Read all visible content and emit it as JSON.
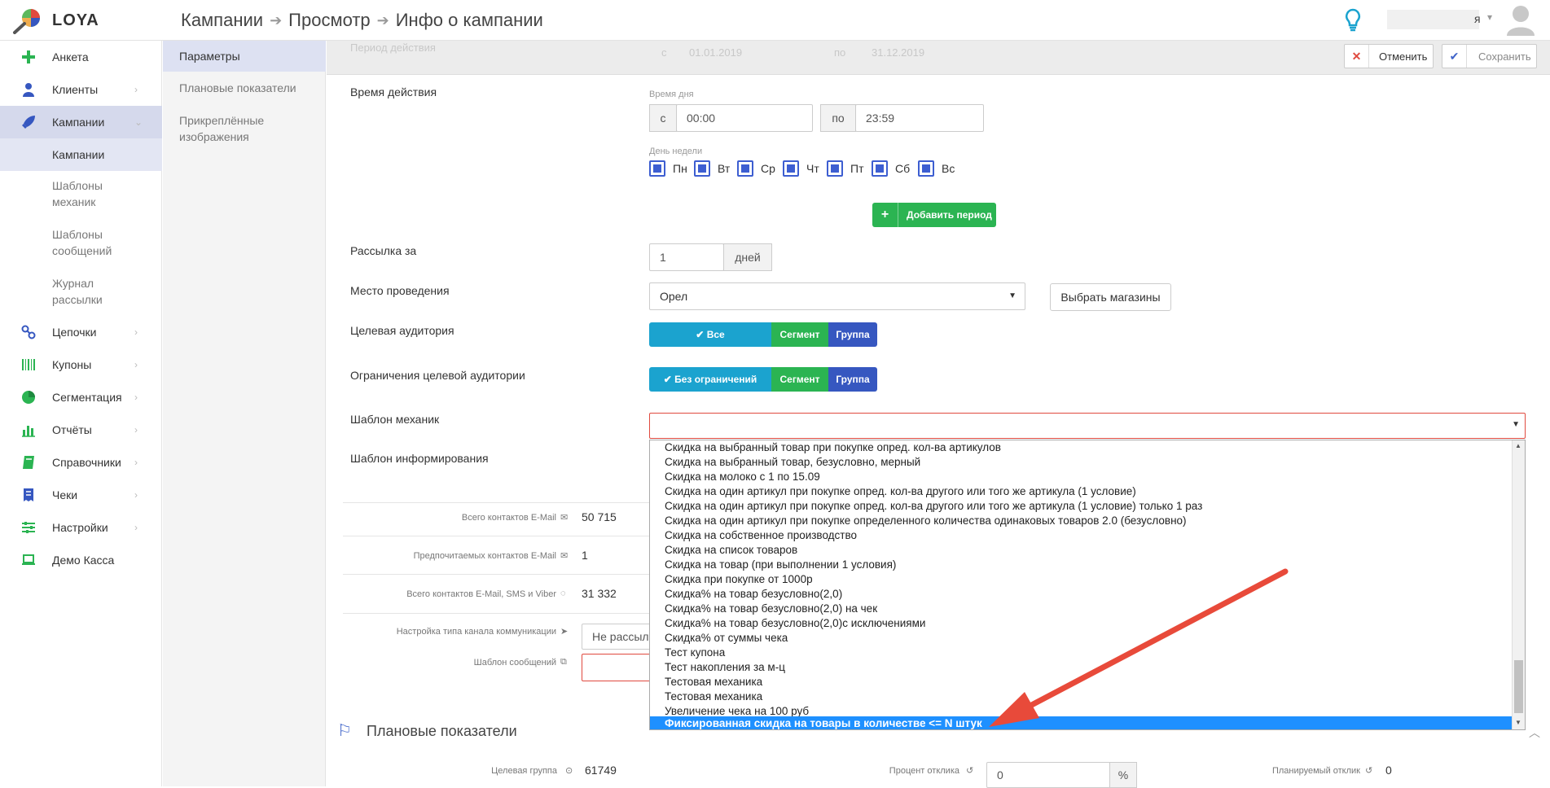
{
  "app": {
    "name": "LOYA"
  },
  "colors": {
    "accent": "#3657c0",
    "green": "#2bb452",
    "blue": "#1ba3cf",
    "error": "#e04a3f",
    "selection": "#1e90ff"
  },
  "breadcrumb": [
    "Кампании",
    "Просмотр",
    "Инфо о кампании"
  ],
  "user": {
    "name_fragment": "я"
  },
  "sidebar": {
    "items": [
      {
        "label": "Анкета",
        "icon": "plus-icon"
      },
      {
        "label": "Клиенты",
        "icon": "user-icon"
      },
      {
        "label": "Кампании",
        "icon": "rocket-icon"
      },
      {
        "label": "Цепочки",
        "icon": "chain-icon"
      },
      {
        "label": "Купоны",
        "icon": "barcode-icon"
      },
      {
        "label": "Сегментация",
        "icon": "pie-chart-icon"
      },
      {
        "label": "Отчёты",
        "icon": "bar-chart-icon"
      },
      {
        "label": "Справочники",
        "icon": "book-icon"
      },
      {
        "label": "Чеки",
        "icon": "receipt-icon"
      },
      {
        "label": "Настройки",
        "icon": "sliders-icon"
      },
      {
        "label": "Демо Касса",
        "icon": "laptop-icon"
      }
    ],
    "sub_items": [
      "Кампании",
      "Шаблоны механик",
      "Шаблоны сообщений",
      "Журнал рассылки"
    ]
  },
  "panel": {
    "items": [
      "Параметры",
      "Плановые показатели",
      "Прикреплённые изображения"
    ]
  },
  "actions": {
    "cancel": "Отменить",
    "save": "Сохранить"
  },
  "period": {
    "label": "Период действия",
    "from_prefix": "с",
    "from": "01.01.2019",
    "to_prefix": "по",
    "to": "31.12.2019"
  },
  "time": {
    "label": "Время действия",
    "day_time_caption": "Время дня",
    "from_prefix": "с",
    "from": "00:00",
    "to_prefix": "по",
    "to": "23:59",
    "weekday_caption": "День недели",
    "days": [
      "Пн",
      "Вт",
      "Ср",
      "Чт",
      "Пт",
      "Сб",
      "Вс"
    ],
    "add_period": "Добавить период"
  },
  "mailing": {
    "label": "Рассылка за",
    "value": "1",
    "unit": "дней"
  },
  "venue": {
    "label": "Место проведения",
    "value": "Орел",
    "choose_stores": "Выбрать магазины"
  },
  "audience": {
    "label": "Целевая аудитория",
    "options": [
      "Все",
      "Сегмент",
      "Группа"
    ]
  },
  "audience_limits": {
    "label": "Ограничения целевой аудитории",
    "options": [
      "Без ограничений",
      "Сегмент",
      "Группа"
    ]
  },
  "mechanics": {
    "label": "Шаблон механик",
    "options": [
      "Скидка на выбранный товар при покупке опред. кол-ва артикулов",
      "Скидка на выбранный товар, безусловно, мерный",
      "Скидка на молоко с 1 по 15.09",
      "Скидка на один артикул при покупке опред. кол-ва другого или того же артикула (1 условие)",
      "Скидка на один артикул при покупке опред. кол-ва другого или того же артикула (1 условие) только 1 раз",
      "Скидка на один артикул при покупке определенного количества одинаковых товаров 2.0 (безусловно)",
      "Скидка на собственное производство",
      "Скидка на список товаров",
      "Скидка на товар (при выполнении 1 условия)",
      "Скидка при покупке от 1000р",
      "Скидка% на товар безусловно(2,0)",
      "Скидка% на товар безусловно(2,0) на чек",
      "Скидка% на товар безусловно(2,0)с исключениями",
      "Скидка% от суммы чека",
      "Тест купона",
      "Тест накопления за м-ц",
      "Тестовая механика",
      "Тестовая механика",
      "Увеличение чека на 100 руб",
      "Фиксированная скидка на товары в количестве <= N штук"
    ],
    "selected_index": 19
  },
  "informing": {
    "label": "Шаблон информирования"
  },
  "contacts": {
    "email_total_label": "Всего контактов E-Mail",
    "email_total": "50 715",
    "email_pref_label": "Предпочитаемых контактов E-Mail",
    "email_pref": "1",
    "all_label": "Всего контактов E-Mail, SMS и Viber",
    "all": "31 332",
    "channel_label": "Настройка типа канала коммуникации",
    "channel_value": "Не рассыл",
    "msg_template_label": "Шаблон сообщений"
  },
  "plan": {
    "title": "Плановые показатели",
    "target_group_label": "Целевая группа",
    "target_group": "61749",
    "response_rate_label": "Процент отклика",
    "response_rate": "0",
    "percent": "%",
    "planned_response_label": "Планируемый отклик",
    "planned_response": "0"
  }
}
